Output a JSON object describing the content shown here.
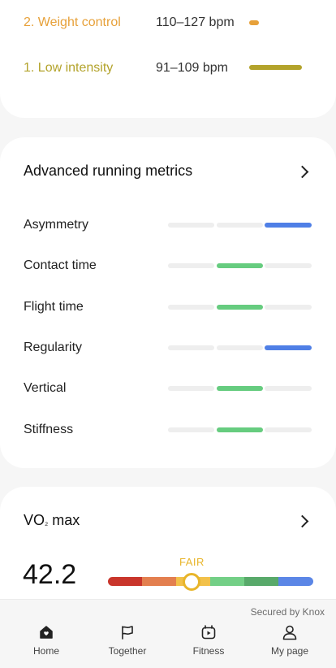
{
  "zones": [
    {
      "label": "2. Weight control",
      "bpm": "110–127 bpm",
      "color": "#e7a13a"
    },
    {
      "label": "1. Low intensity",
      "bpm": "91–109 bpm",
      "color": "#b3a32b"
    }
  ],
  "advanced": {
    "title": "Advanced running metrics",
    "metrics": [
      {
        "label": "Asymmetry",
        "level": 3,
        "color": "#4f7fe6"
      },
      {
        "label": "Contact time",
        "level": 2,
        "color": "#66cc7f"
      },
      {
        "label": "Flight time",
        "level": 2,
        "color": "#66cc7f"
      },
      {
        "label": "Regularity",
        "level": 3,
        "color": "#4f7fe6"
      },
      {
        "label": "Vertical",
        "level": 2,
        "color": "#66cc7f"
      },
      {
        "label": "Stiffness",
        "level": 2,
        "color": "#66cc7f"
      }
    ]
  },
  "vo2": {
    "title_main": "VO",
    "title_sub": "₂",
    "title_rest": " max",
    "value": "42.2",
    "rating": "FAIR",
    "gauge_colors": [
      "#c9352b",
      "#e37f4f",
      "#f2c14a",
      "#73cf86",
      "#58a96a",
      "#5b86e6"
    ]
  },
  "footer": {
    "secured": "Secured by Knox",
    "nav": [
      {
        "label": "Home",
        "icon": "home-icon"
      },
      {
        "label": "Together",
        "icon": "flag-icon"
      },
      {
        "label": "Fitness",
        "icon": "fitness-icon"
      },
      {
        "label": "My page",
        "icon": "person-icon"
      }
    ]
  }
}
